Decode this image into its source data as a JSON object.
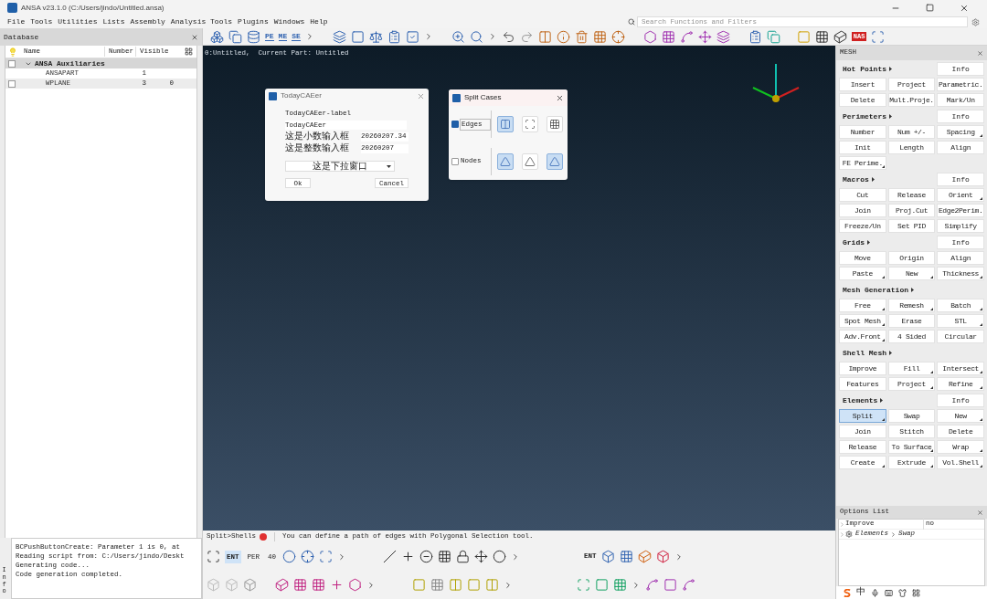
{
  "window": {
    "title": "ANSA v23.1.0 (C:/Users/jindo/Untitled.ansa)"
  },
  "menu": [
    "File",
    "Tools",
    "Utilities",
    "Lists",
    "Assembly",
    "Analysis Tools",
    "Plugins",
    "Windows",
    "Help"
  ],
  "search": {
    "placeholder": "Search Functions and Filters"
  },
  "toolbar": [
    {
      "kind": "letters",
      "label": "PE"
    },
    {
      "kind": "letters",
      "label": "ME"
    },
    {
      "kind": "letters",
      "label": "SE"
    },
    {
      "kind": "letters",
      "label": "NAS"
    }
  ],
  "database": {
    "title": "Database",
    "columns": [
      "Name",
      "Number",
      "Visible"
    ],
    "rows": [
      {
        "name": "ANSA Auxiliaries",
        "checked": false,
        "expanded": true,
        "children": [
          {
            "name": "ANSAPART",
            "number": "1"
          },
          {
            "name": "WPLANE",
            "number": "3",
            "visible": "0",
            "checked": false
          }
        ]
      }
    ]
  },
  "console": {
    "title": "Info",
    "lines": [
      "BCPushButtonCreate: Parameter 1 is 0, at",
      "Reading script from: C:/Users/jindo/Deskt",
      "Generating code...",
      "Code generation completed."
    ]
  },
  "viewport": {
    "caption": "0:Untitled,  Current Part: Untitled"
  },
  "dialog": {
    "title": "TodayCAEer",
    "label": "TodayCAEer-label",
    "text_value": "TodayCAEer",
    "fields": [
      {
        "label": "这是小数输入框",
        "value": "20260207.34"
      },
      {
        "label": "这是整数输入框",
        "value": "20260207"
      }
    ],
    "dropdown": "这是下拉窗口",
    "buttons": [
      "Ok",
      "Cancel"
    ]
  },
  "split_cases": {
    "title": "Split Cases",
    "options": [
      {
        "label": "Edges",
        "checked": true,
        "cases": [
          {
            "selected": true
          },
          {
            "selected": false
          },
          {
            "selected": false
          }
        ]
      },
      {
        "label": "Nodes",
        "checked": false,
        "cases": [
          {
            "selected": true
          },
          {
            "selected": false
          },
          {
            "selected": true
          }
        ]
      }
    ]
  },
  "status": {
    "mode": "Split>Shells",
    "message": "You can define a path of edges with Polygonal Selection tool."
  },
  "bottom_toolbar": [
    {
      "label": "ENT",
      "selected": true
    },
    {
      "label": "PER",
      "selected": false
    },
    {
      "label": "40",
      "selected": false
    }
  ],
  "bottom_toolbar_right": {
    "label": "ENT"
  },
  "mesh": {
    "title": "MESH",
    "sections": [
      {
        "title": "Hot Points",
        "info": "Info",
        "buttons": [
          {
            "label": "Insert",
            "menu": false,
            "selected": false
          },
          {
            "label": "Project",
            "menu": false,
            "selected": false
          },
          {
            "label": "Parametric.",
            "menu": false,
            "selected": false
          },
          {
            "label": "Delete",
            "menu": false,
            "selected": false
          },
          {
            "label": "Mult.Proje.",
            "menu": false,
            "selected": false
          },
          {
            "label": "Mark/Un",
            "menu": false,
            "selected": false
          }
        ]
      },
      {
        "title": "Perimeters",
        "info": "Info",
        "buttons": [
          {
            "label": "Number",
            "menu": false,
            "selected": false
          },
          {
            "label": "Num +/-",
            "menu": false,
            "selected": false
          },
          {
            "label": "Spacing",
            "menu": true,
            "selected": false
          },
          {
            "label": "Init",
            "menu": false,
            "selected": false
          },
          {
            "label": "Length",
            "menu": false,
            "selected": false
          },
          {
            "label": "Align",
            "menu": false,
            "selected": false
          },
          {
            "label": "FE Perime.",
            "menu": true,
            "selected": false
          }
        ]
      },
      {
        "title": "Macros",
        "info": "Info",
        "buttons": [
          {
            "label": "Cut",
            "menu": false,
            "selected": false
          },
          {
            "label": "Release",
            "menu": false,
            "selected": false
          },
          {
            "label": "Orient",
            "menu": true,
            "selected": false
          },
          {
            "label": "Join",
            "menu": false,
            "selected": false
          },
          {
            "label": "Proj.Cut",
            "menu": false,
            "selected": false
          },
          {
            "label": "Edge2Perim.",
            "menu": false,
            "selected": false
          },
          {
            "label": "Freeze/Un",
            "menu": false,
            "selected": false
          },
          {
            "label": "Set PID",
            "menu": false,
            "selected": false
          },
          {
            "label": "Simplify",
            "menu": false,
            "selected": false
          }
        ]
      },
      {
        "title": "Grids",
        "info": "Info",
        "buttons": [
          {
            "label": "Move",
            "menu": false,
            "selected": false
          },
          {
            "label": "Origin",
            "menu": false,
            "selected": false
          },
          {
            "label": "Align",
            "menu": false,
            "selected": false
          },
          {
            "label": "Paste",
            "menu": true,
            "selected": false
          },
          {
            "label": "New",
            "menu": true,
            "selected": false
          },
          {
            "label": "Thickness",
            "menu": true,
            "selected": false
          }
        ]
      },
      {
        "title": "Mesh Generation",
        "buttons": [
          {
            "label": "Free",
            "menu": true,
            "selected": false
          },
          {
            "label": "Remesh",
            "menu": true,
            "selected": false
          },
          {
            "label": "Batch",
            "menu": true,
            "selected": false
          },
          {
            "label": "Spot Mesh",
            "menu": true,
            "selected": false
          },
          {
            "label": "Erase",
            "menu": false,
            "selected": false
          },
          {
            "label": "STL",
            "menu": true,
            "selected": false
          },
          {
            "label": "Adv.Front",
            "menu": true,
            "selected": false
          },
          {
            "label": "4 Sided",
            "menu": false,
            "selected": false
          },
          {
            "label": "Circular",
            "menu": false,
            "selected": false
          }
        ]
      },
      {
        "title": "Shell Mesh",
        "buttons": [
          {
            "label": "Improve",
            "menu": false,
            "selected": false
          },
          {
            "label": "Fill",
            "menu": true,
            "selected": false
          },
          {
            "label": "Intersect",
            "menu": true,
            "selected": false
          },
          {
            "label": "Features",
            "menu": false,
            "selected": false
          },
          {
            "label": "Project",
            "menu": true,
            "selected": false
          },
          {
            "label": "Refine",
            "menu": true,
            "selected": false
          }
        ]
      },
      {
        "title": "Elements",
        "info": "Info",
        "buttons": [
          {
            "label": "Split",
            "menu": true,
            "selected": true
          },
          {
            "label": "Swap",
            "menu": false,
            "selected": false
          },
          {
            "label": "New",
            "menu": true,
            "selected": false
          },
          {
            "label": "Join",
            "menu": false,
            "selected": false
          },
          {
            "label": "Stitch",
            "menu": false,
            "selected": false
          },
          {
            "label": "Delete",
            "menu": false,
            "selected": false
          },
          {
            "label": "Release",
            "menu": false,
            "selected": false
          },
          {
            "label": "To Surface",
            "menu": true,
            "selected": false
          },
          {
            "label": "Wrap",
            "menu": true,
            "selected": false
          },
          {
            "label": "Create",
            "menu": true,
            "selected": false
          },
          {
            "label": "Extrude",
            "menu": true,
            "selected": false
          },
          {
            "label": "Vol.Shell",
            "menu": true,
            "selected": false
          }
        ]
      }
    ]
  },
  "options_list": {
    "title": "Options List",
    "rows": [
      {
        "name": "Improve",
        "value": "no"
      },
      {
        "path": [
          "Elements",
          "Swap"
        ]
      }
    ]
  },
  "taskbar": {
    "ime": "中"
  }
}
